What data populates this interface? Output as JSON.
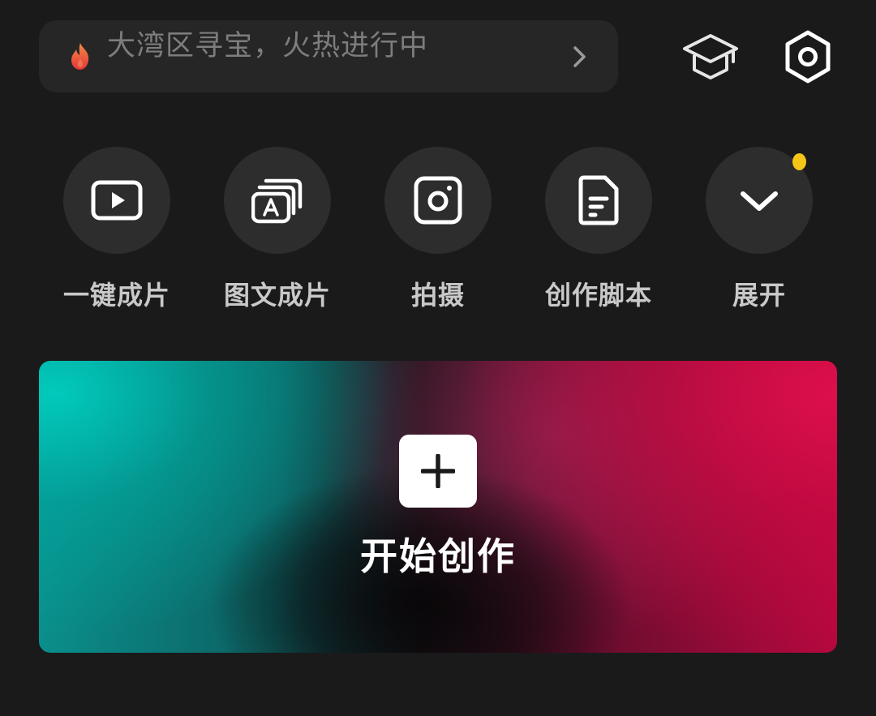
{
  "search": {
    "text": "大湾区寻宝，火热进行中",
    "leading_icon": "fire-icon",
    "trailing_icon": "chevron-right-icon"
  },
  "top_icons": [
    {
      "name": "graduation-cap-icon"
    },
    {
      "name": "settings-hexagon-icon"
    }
  ],
  "quick_actions": [
    {
      "label": "一键成片",
      "icon": "play-video-icon"
    },
    {
      "label": "图文成片",
      "icon": "text-layers-icon"
    },
    {
      "label": "拍摄",
      "icon": "camera-icon"
    },
    {
      "label": "创作脚本",
      "icon": "script-document-icon"
    },
    {
      "label": "展开",
      "icon": "chevron-down-icon",
      "badge": "notification-dot"
    }
  ],
  "create": {
    "label": "开始创作",
    "icon": "plus-icon"
  },
  "colors": {
    "background": "#1a1a1a",
    "surface": "#262626",
    "circle": "#2d2d2d",
    "muted_text": "#7d7d7d",
    "label_text": "#c9c9c9",
    "fire_start": "#f26b3a",
    "fire_end": "#e8323a",
    "badge_dot": "#f5c518",
    "accent_teal": "#00c9bd",
    "accent_red": "#d10f4b"
  }
}
